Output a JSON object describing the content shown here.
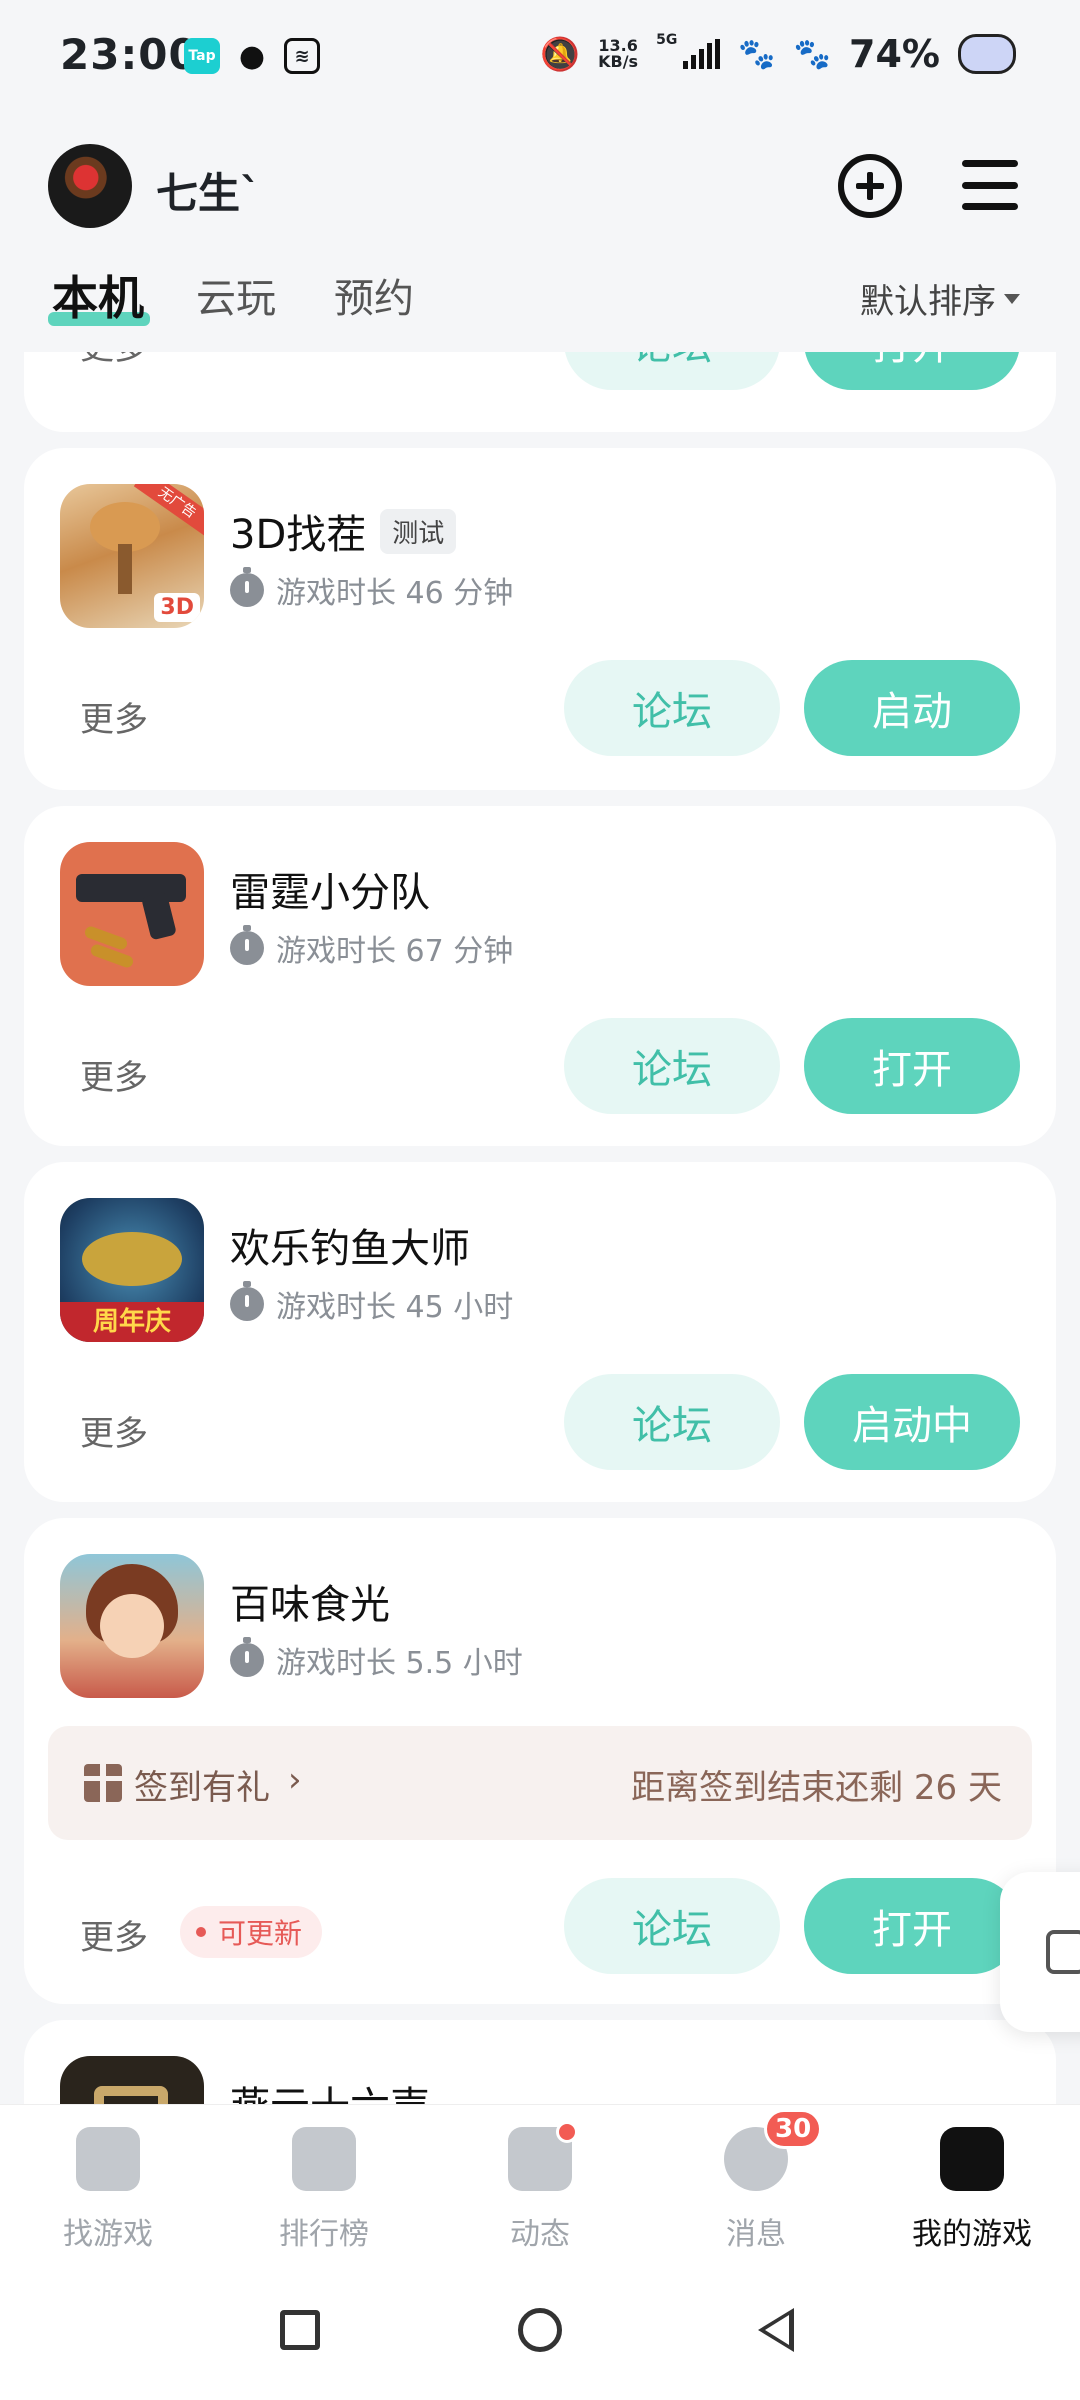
{
  "status_bar": {
    "time": "23:00",
    "tap_icon": "Tap",
    "speed_value": "13.6",
    "speed_unit": "KB/s",
    "network": "5G",
    "battery": "74%",
    "icons": [
      "taptap-icon",
      "qq-icon",
      "notification-app-icon",
      "mute-bell-icon",
      "signal-icon",
      "paw-icon",
      "paw-icon",
      "cat-battery-icon"
    ]
  },
  "header": {
    "username": "七生`",
    "add_icon": "plus-circle-icon",
    "menu_icon": "hamburger-menu-icon"
  },
  "tabs": {
    "items": [
      {
        "label": "本机",
        "active": true
      },
      {
        "label": "云玩",
        "active": false
      },
      {
        "label": "预约",
        "active": false
      }
    ],
    "sort_label": "默认排序"
  },
  "games": [
    {
      "name": "",
      "more": "更多",
      "forum": "论坛",
      "action": "打开"
    },
    {
      "name": "3D找茬",
      "tag": "测试",
      "playtime": "游戏时长 46 分钟",
      "more": "更多",
      "forum": "论坛",
      "action": "启动",
      "icon_text": "3D",
      "icon_ribbon": "无广告"
    },
    {
      "name": "雷霆小分队",
      "playtime": "游戏时长 67 分钟",
      "more": "更多",
      "forum": "论坛",
      "action": "打开"
    },
    {
      "name": "欢乐钓鱼大师",
      "playtime": "游戏时长 45 小时",
      "more": "更多",
      "forum": "论坛",
      "action": "启动中",
      "icon_text": "周年庆"
    },
    {
      "name": "百味食光",
      "playtime": "游戏时长 5.5 小时",
      "more": "更多",
      "forum": "论坛",
      "action": "打开",
      "update_badge": "可更新",
      "signin": {
        "label": "签到有礼",
        "chevron": "›",
        "remaining": "距离签到结束还剩 26 天"
      }
    },
    {
      "name": "燕云十六声"
    }
  ],
  "bottom_nav": {
    "items": [
      {
        "label": "找游戏",
        "icon": "find-game-icon"
      },
      {
        "label": "排行榜",
        "icon": "leaderboard-icon"
      },
      {
        "label": "动态",
        "icon": "feed-icon",
        "dot": true
      },
      {
        "label": "消息",
        "icon": "message-icon",
        "badge": "30"
      },
      {
        "label": "我的游戏",
        "icon": "my-games-icon",
        "active": true
      }
    ]
  },
  "colors": {
    "accent": "#5ed4bd",
    "accent_light": "#e6f7f4",
    "update_red": "#e65a57",
    "badge_red": "#f25c54"
  }
}
